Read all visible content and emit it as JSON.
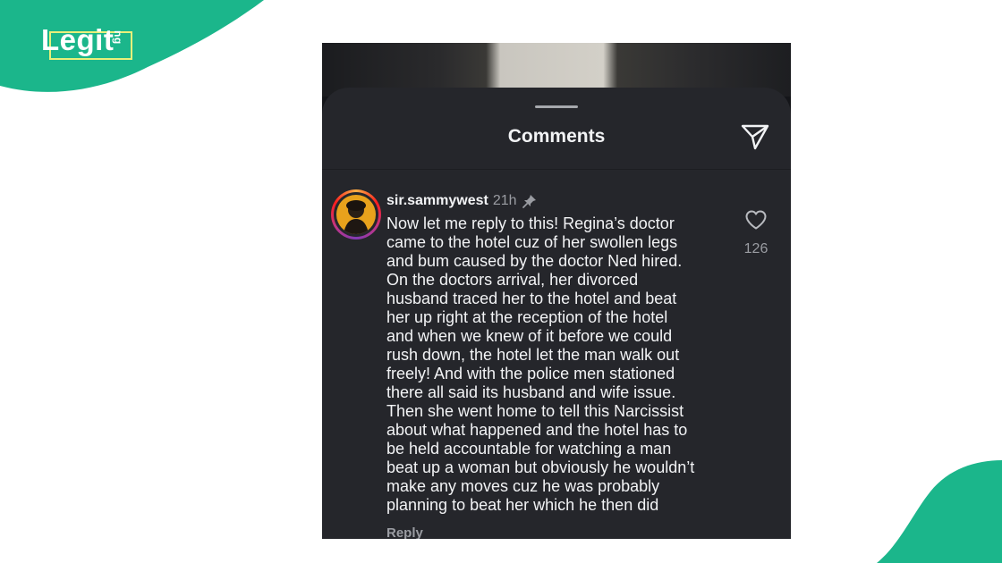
{
  "brand": {
    "logo_word": "Legit",
    "logo_tld": "ng",
    "accent_color": "#1bb68b",
    "box_color": "#e9f07a"
  },
  "sheet": {
    "title": "Comments",
    "share_icon": "send-icon"
  },
  "comment": {
    "username": "sir.sammywest",
    "time": "21h",
    "pinned_icon": "pin-icon",
    "likes": "126",
    "like_icon": "heart-icon",
    "reply_label": "Reply",
    "lines": [
      "Now let me reply to this! Regina’s doctor",
      "came to the hotel cuz of her swollen legs",
      "and bum caused by the doctor Ned hired.",
      "On the doctors arrival, her divorced",
      "husband traced her to the hotel and beat",
      "her up right at the reception of the hotel",
      "and when we knew of it before we could",
      "rush down, the hotel let the man walk out",
      "freely! And with the police men stationed",
      "there all said its husband and wife issue.",
      "Then she went home to tell this Narcissist",
      "about what happened and the hotel has to",
      "be held accountable for watching a man",
      "beat up a woman but obviously he wouldn’t",
      "make any moves cuz he was probably",
      "planning to beat her which he then did"
    ]
  }
}
